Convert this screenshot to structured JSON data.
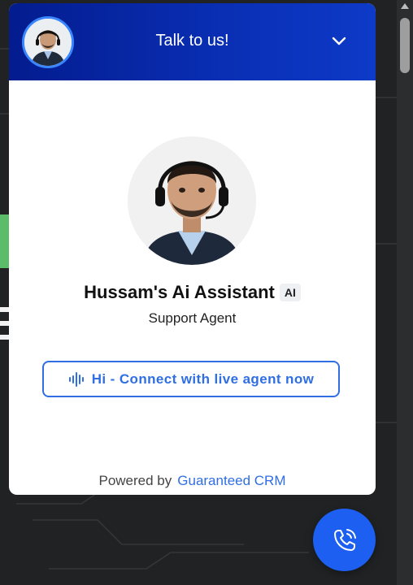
{
  "header": {
    "title": "Talk to us!",
    "avatar_icon": "person-avatar-icon",
    "collapse_icon": "chevron-down-icon"
  },
  "profile": {
    "name": "Hussam's Ai Assistant",
    "badge": "AI",
    "role": "Support Agent"
  },
  "connect_button": {
    "label": "Hi - Connect with live agent now",
    "icon": "waveform-icon"
  },
  "footer": {
    "powered_by": "Powered by",
    "brand": "Guaranteed CRM"
  },
  "call_button": {
    "icon": "phone-icon"
  },
  "colors": {
    "header_start": "#031c8f",
    "header_end": "#0d3ac8",
    "accent": "#2f6fe3",
    "fab": "#1d5ff0"
  }
}
